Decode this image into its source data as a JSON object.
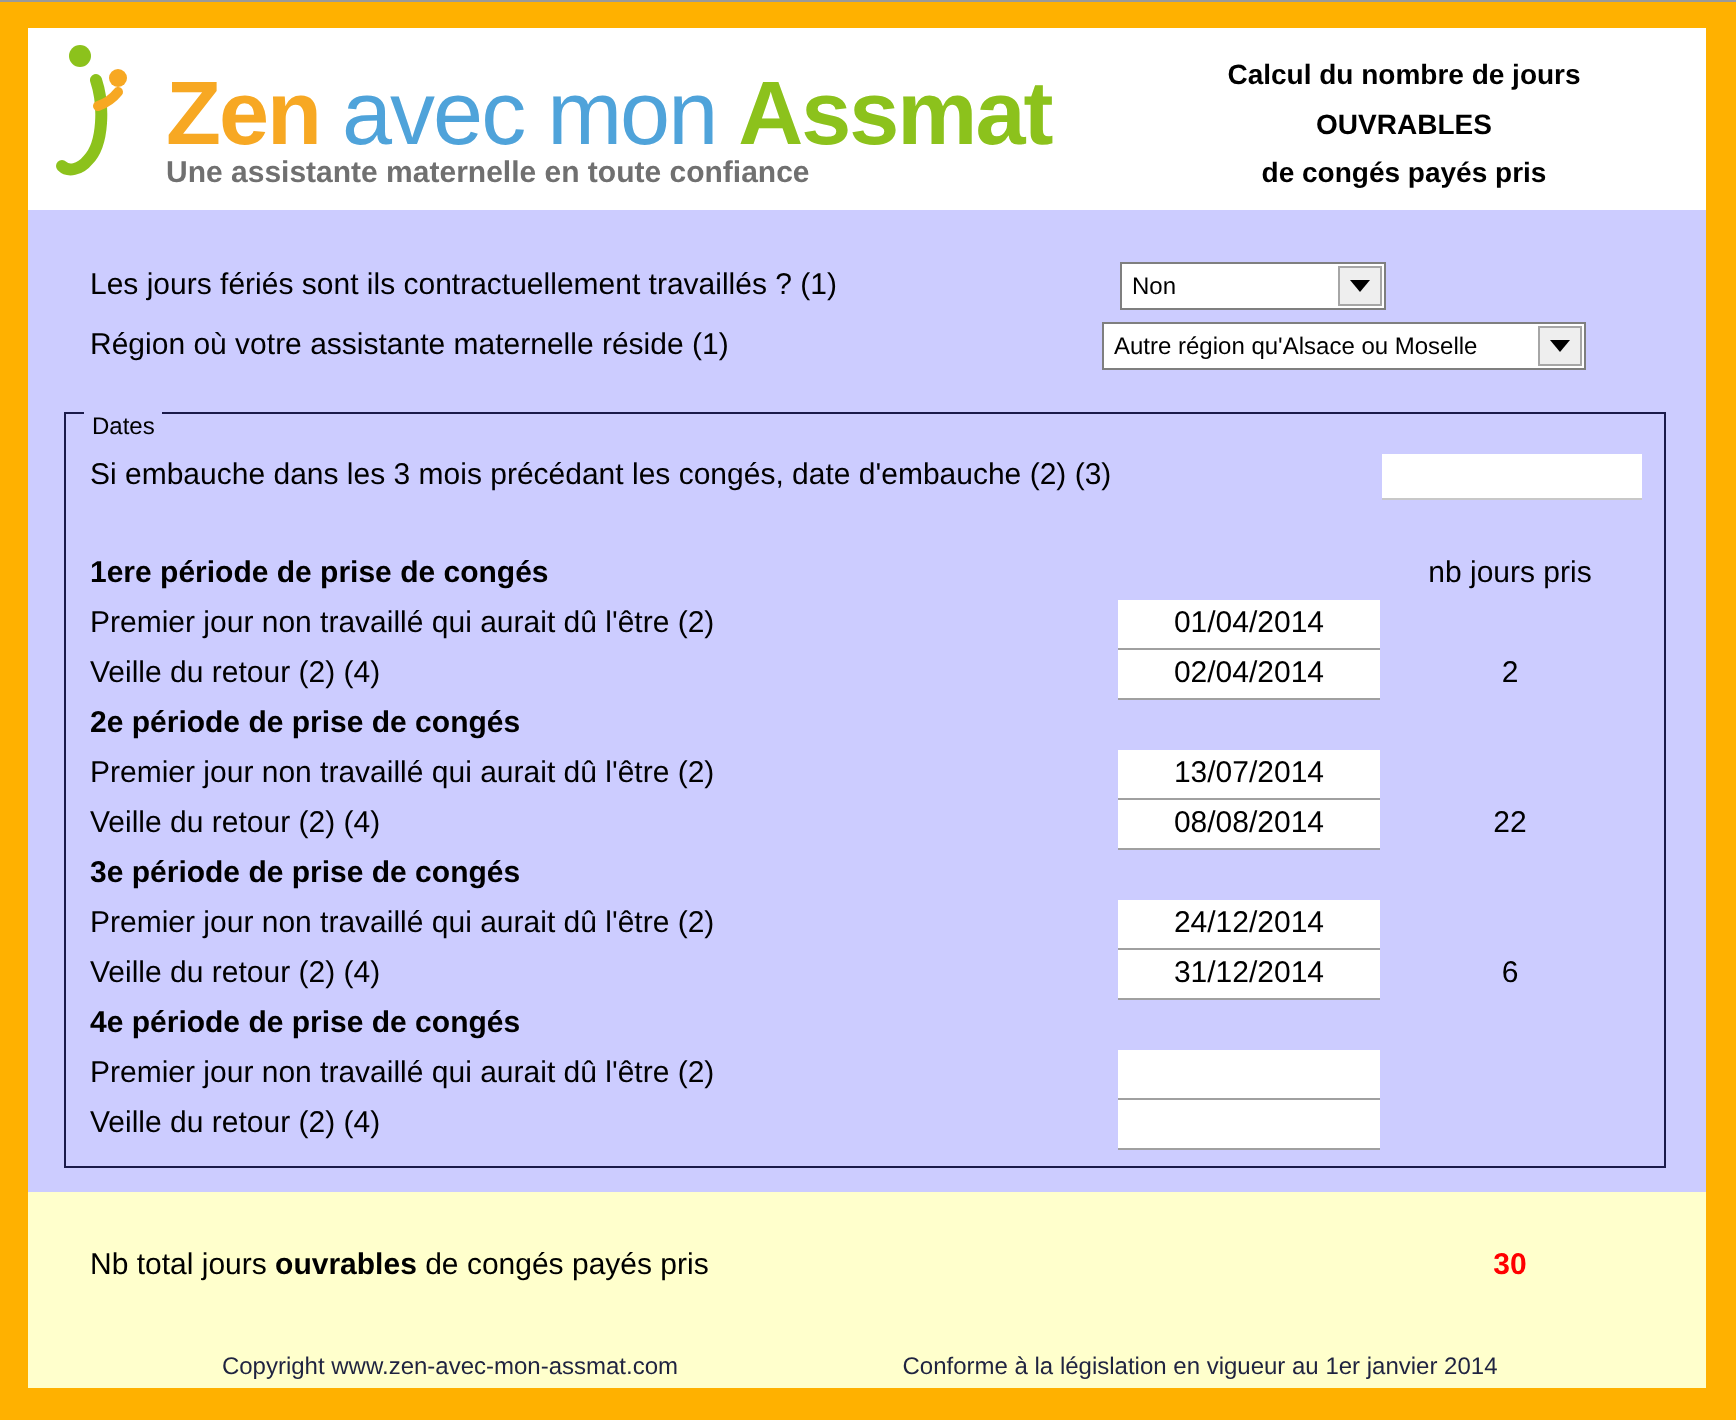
{
  "header": {
    "logo": {
      "words": [
        {
          "text": "Zen",
          "color": "#f7a823"
        },
        {
          "text": "avec mon",
          "color": "#4fa3da"
        },
        {
          "text": "Assmat",
          "color": "#8cc21c"
        }
      ],
      "tagline": "Une assistante maternelle en toute confiance"
    },
    "title_lines": [
      "Calcul du nombre de jours",
      "OUVRABLES",
      "de congés payés pris"
    ]
  },
  "settings": [
    {
      "label": "Les jours fériés sont ils contractuellement travaillés ? (1)",
      "value": "Non"
    },
    {
      "label": "Région où votre assistante maternelle réside (1)",
      "value": "Autre région qu'Alsace ou Moselle"
    }
  ],
  "dates": {
    "legend": "Dates",
    "hire_date": {
      "label": "Si embauche dans les 3 mois précédant les congés, date d'embauche (2) (3)"
    },
    "count_header": "nb jours pris",
    "periods": [
      {
        "title": "1ere période de prise de congés",
        "fields": [
          {
            "label": "Premier jour non travaillé qui aurait dû l'être (2)",
            "value": "01/04/2014"
          },
          {
            "label": "Veille du retour (2) (4)",
            "value": "02/04/2014"
          }
        ],
        "days": "2"
      },
      {
        "title": "2e période de prise de congés",
        "fields": [
          {
            "label": "Premier jour non travaillé qui aurait dû l'être (2)",
            "value": "13/07/2014"
          },
          {
            "label": "Veille du retour (2) (4)",
            "value": "08/08/2014"
          }
        ],
        "days": "22"
      },
      {
        "title": "3e période de prise de congés",
        "fields": [
          {
            "label": "Premier jour non travaillé qui aurait dû l'être (2)",
            "value": "24/12/2014"
          },
          {
            "label": "Veille du retour (2) (4)",
            "value": "31/12/2014"
          }
        ],
        "days": "6"
      },
      {
        "title": "4e période de prise de congés",
        "fields": [
          {
            "label": "Premier jour non travaillé qui aurait dû l'être (2)"
          },
          {
            "label": "Veille du retour (2) (4)"
          }
        ]
      }
    ]
  },
  "total": {
    "label": "Nb total jours **ouvrables** de congés payés pris",
    "value": "30"
  },
  "footer": [
    "Copyright www.zen-avec-mon-assmat.com",
    "Conforme à la législation en vigueur au 1er janvier 2014"
  ]
}
